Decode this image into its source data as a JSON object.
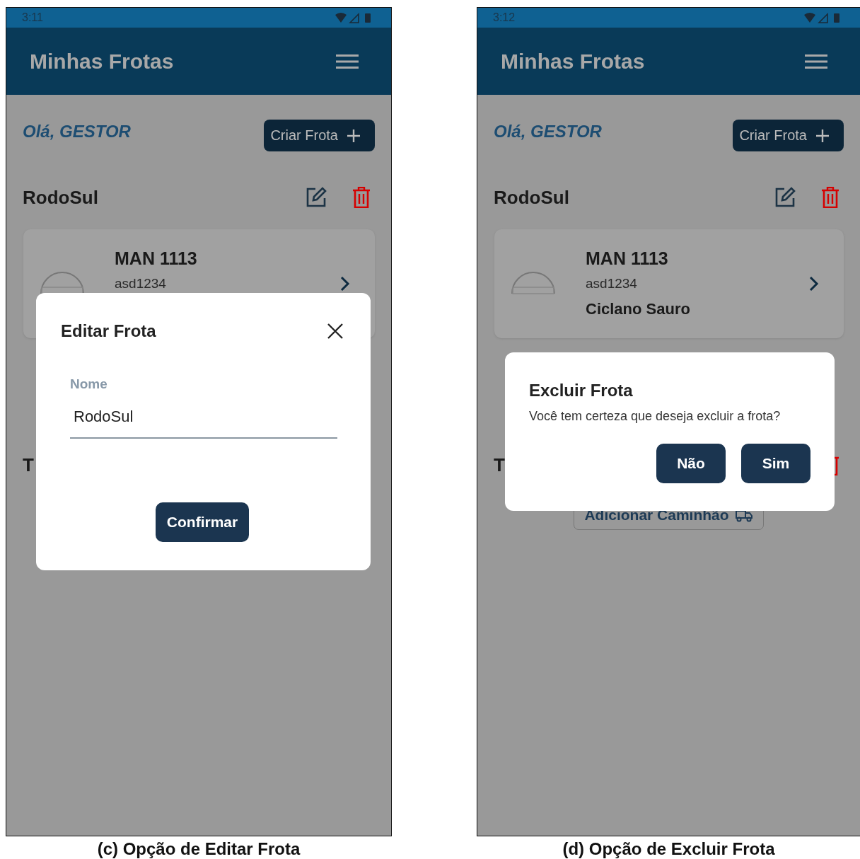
{
  "screens": [
    {
      "status_bar": {
        "time": "3:11"
      },
      "app_bar": {
        "title": "Minhas Frotas"
      },
      "greeting": "Olá, GESTOR",
      "create_button": "Criar Frota",
      "fleets": [
        {
          "name": "RodoSul",
          "editable": true,
          "deletable": true,
          "trucks": [
            {
              "model": "MAN 1113",
              "plate": "asd1234"
            }
          ]
        },
        {
          "name": "T"
        }
      ],
      "dialog": {
        "kind": "edit",
        "title": "Editar Frota",
        "field_label": "Nome",
        "field_value": "RodoSul",
        "confirm_button": "Confirmar"
      },
      "caption": "(c) Opção de Editar Frota"
    },
    {
      "status_bar": {
        "time": "3:12"
      },
      "app_bar": {
        "title": "Minhas Frotas"
      },
      "greeting": "Olá, GESTOR",
      "create_button": "Criar Frota",
      "fleets": [
        {
          "name": "RodoSul",
          "editable": true,
          "deletable": true,
          "trucks": [
            {
              "model": "MAN 1113",
              "plate": "asd1234",
              "driver": "Ciclano Sauro"
            }
          ]
        },
        {
          "name": "T",
          "deletable": true,
          "add_button": "Adicionar Caminhão"
        }
      ],
      "dialog": {
        "kind": "confirm",
        "title": "Excluir Frota",
        "message": "Você tem certeza que deseja excluir a frota?",
        "buttons": [
          "Não",
          "Sim"
        ]
      },
      "caption": "(d) Opção de Excluir Frota"
    }
  ]
}
